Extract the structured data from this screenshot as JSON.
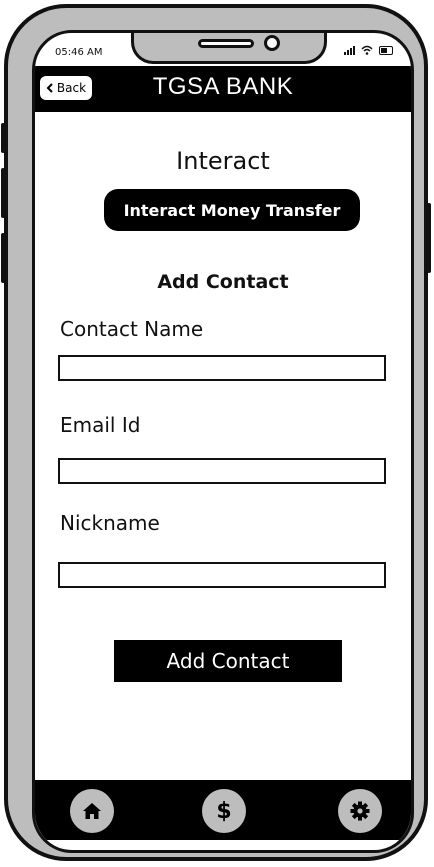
{
  "status_bar": {
    "time": "05:46 AM"
  },
  "header": {
    "back_label": "Back",
    "title": "TGSA BANK"
  },
  "main": {
    "section_title": "Interact",
    "transfer_button": "Interact Money Transfer",
    "form_heading": "Add Contact",
    "fields": [
      {
        "label": "Contact Name",
        "value": ""
      },
      {
        "label": "Email Id",
        "value": ""
      },
      {
        "label": "Nickname",
        "value": ""
      }
    ],
    "submit_label": "Add Contact"
  },
  "bottom_nav": [
    {
      "icon": "home-icon"
    },
    {
      "icon": "dollar-icon",
      "glyph": "$"
    },
    {
      "icon": "gear-icon"
    }
  ]
}
